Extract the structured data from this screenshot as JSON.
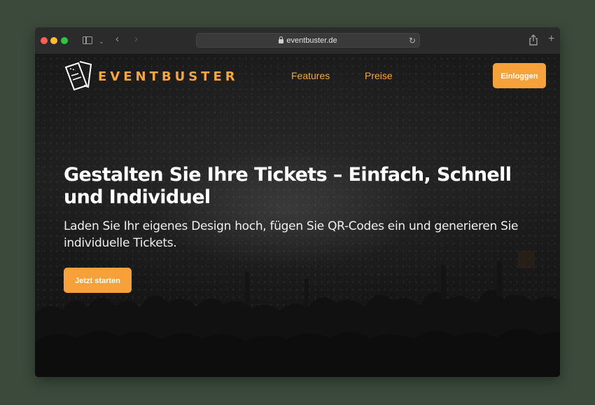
{
  "browser": {
    "url": "eventbuster.de",
    "icons": [
      "lock-icon",
      "reload-icon",
      "share-icon",
      "new-tab-icon",
      "back-icon",
      "forward-icon",
      "sidebar-icon",
      "chevron-down-icon"
    ]
  },
  "nav": {
    "brand": "EVENTBUSTER",
    "links": [
      {
        "label": "Features"
      },
      {
        "label": "Preise"
      }
    ],
    "login_label": "Einloggen"
  },
  "hero": {
    "title": "Gestalten Sie Ihre Tickets – Einfach, Schnell und Individuel",
    "subtitle": "Laden Sie Ihr eigenes Design hoch, fügen Sie QR-Codes ein und generieren Sie individuelle Tickets.",
    "cta_label": "Jetzt starten"
  },
  "colors": {
    "accent": "#f7a13a",
    "desktop": "#3b4a3b",
    "chrome": "#2b2b2b"
  }
}
